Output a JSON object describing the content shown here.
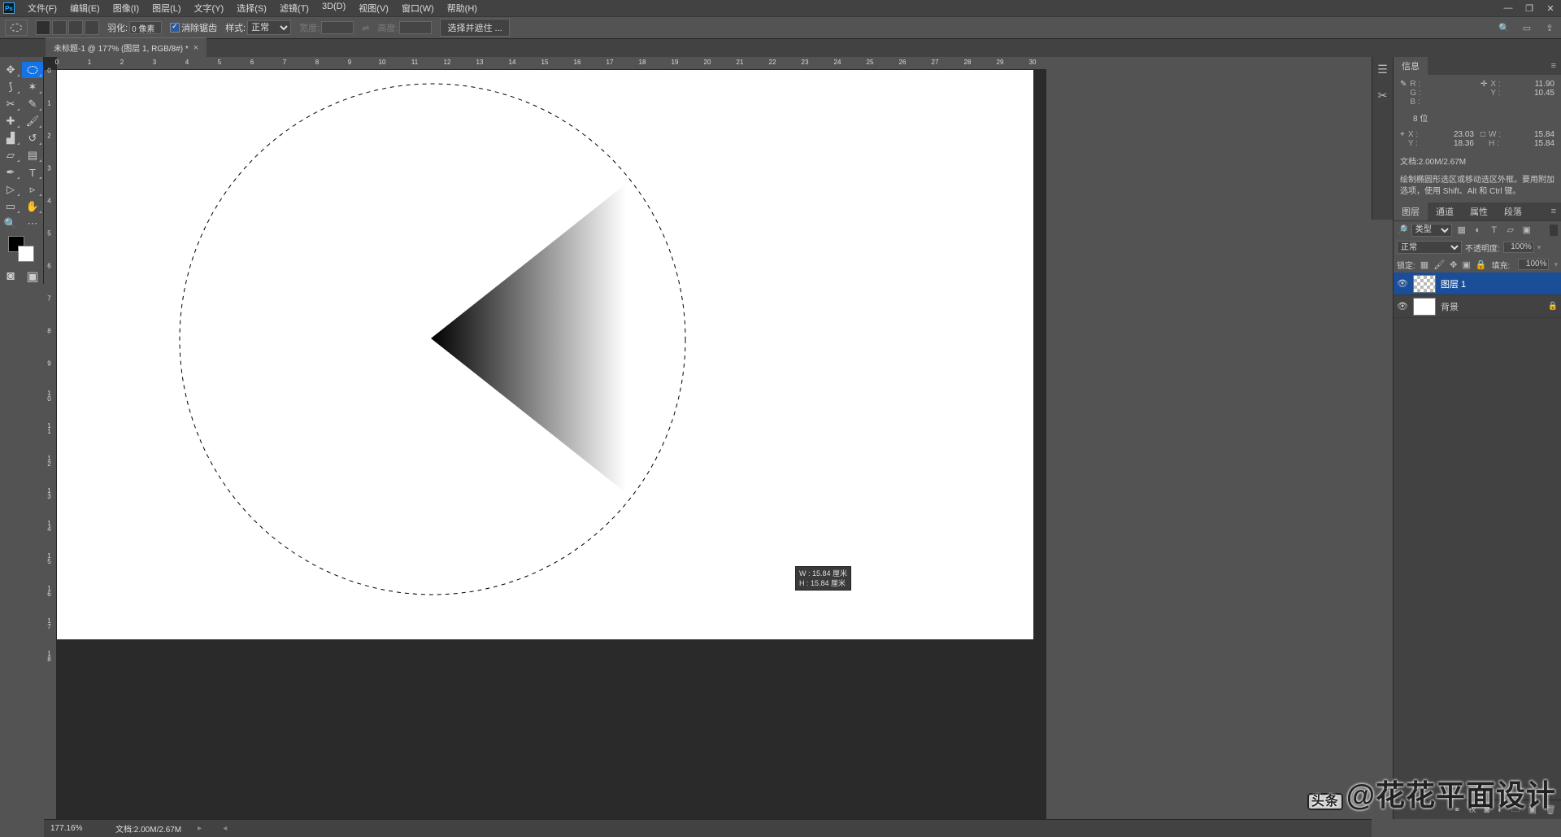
{
  "menu": {
    "items": [
      "文件(F)",
      "编辑(E)",
      "图像(I)",
      "图层(L)",
      "文字(Y)",
      "选择(S)",
      "滤镜(T)",
      "3D(D)",
      "视图(V)",
      "窗口(W)",
      "帮助(H)"
    ]
  },
  "options": {
    "feather_label": "羽化:",
    "feather_value": "0 像素",
    "antialias": "消除锯齿",
    "style_label": "样式:",
    "style_value": "正常",
    "width_label": "宽度:",
    "swap_icon": "⇌",
    "height_label": "高度:",
    "refine_btn": "选择并遮住 ..."
  },
  "tab": {
    "title": "未标题-1 @ 177% (图层 1, RGB/8#) *"
  },
  "ruler_h": [
    "0",
    "1",
    "2",
    "3",
    "4",
    "5",
    "6",
    "7",
    "8",
    "9",
    "10",
    "11",
    "12",
    "13",
    "14",
    "15",
    "16",
    "17",
    "18",
    "19",
    "20",
    "21",
    "22",
    "23",
    "24",
    "25",
    "26",
    "27",
    "28",
    "29",
    "30"
  ],
  "ruler_v": [
    "0",
    "1",
    "2",
    "3",
    "4",
    "5",
    "6",
    "7",
    "8",
    "9",
    "10",
    "11",
    "12",
    "13",
    "14",
    "15",
    "16",
    "17",
    "18"
  ],
  "tooltip": {
    "w_label": "W :",
    "w_val": "15.84 厘米",
    "h_label": "H :",
    "h_val": "15.84 厘米"
  },
  "info": {
    "tab": "信息",
    "rgb": {
      "R": "R :",
      "G": "G :",
      "B": "B :",
      "Rv": "",
      "Gv": "",
      "Bv": ""
    },
    "xy": {
      "X": "X :",
      "Y": "Y :",
      "Xv": "11.90",
      "Yv": "10.45"
    },
    "bits": "8 位",
    "wh_src": {
      "X": "X :",
      "Y": "Y :",
      "Xv": "23.03",
      "Yv": "18.36"
    },
    "wh": {
      "W": "W :",
      "H": "H :",
      "Wv": "15.84",
      "Hv": "15.84"
    },
    "doc": "文档:2.00M/2.67M",
    "hint": "绘制椭圆形选区或移动选区外框。要用附加选项，使用 Shift、Alt 和 Ctrl 键。"
  },
  "layers": {
    "tabs": [
      "图层",
      "通道",
      "属性",
      "段落"
    ],
    "filter": "类型",
    "blend": "正常",
    "opacity_label": "不透明度:",
    "opacity_val": "100%",
    "lock_label": "锁定:",
    "fill_label": "填充:",
    "fill_val": "100%",
    "items": [
      {
        "name": "图层 1",
        "thumb": "checker",
        "active": true,
        "locked": false
      },
      {
        "name": "背景",
        "thumb": "white",
        "active": false,
        "locked": true
      }
    ]
  },
  "status": {
    "zoom": "177.16%",
    "doc": "文档:2.00M/2.67M"
  },
  "watermark": "@花花平面设计",
  "watermark_prefix": "头条"
}
